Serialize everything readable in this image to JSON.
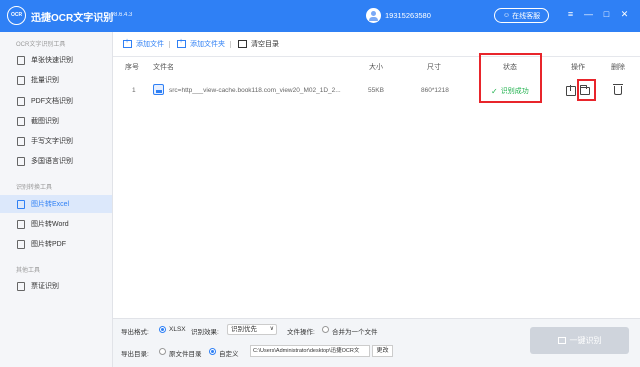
{
  "app": {
    "logo_text": "OCR",
    "title": "迅捷OCR文字识别",
    "version": "v8.6.4.3",
    "user_phone": "19315263580",
    "service_label": "在线客服"
  },
  "window_controls": {
    "menu": "≡",
    "minimize": "—",
    "maximize": "□",
    "close": "✕"
  },
  "sidebar": {
    "sections": [
      {
        "title": "OCR文字识别工具",
        "items": [
          {
            "label": "单张快速识别",
            "icon": "image-icon"
          },
          {
            "label": "批量识别",
            "icon": "batch-icon"
          },
          {
            "label": "PDF文档识别",
            "icon": "pdf-icon"
          },
          {
            "label": "截图识别",
            "icon": "screenshot-icon"
          },
          {
            "label": "手写文字识别",
            "icon": "handwriting-icon"
          },
          {
            "label": "多国语言识别",
            "icon": "globe-icon"
          }
        ]
      },
      {
        "title": "识别转换工具",
        "items": [
          {
            "label": "图片转Excel",
            "icon": "excel-icon",
            "active": true
          },
          {
            "label": "图片转Word",
            "icon": "word-icon"
          },
          {
            "label": "图片转PDF",
            "icon": "pdf-icon"
          }
        ]
      },
      {
        "title": "其他工具",
        "items": [
          {
            "label": "票证识别",
            "icon": "ticket-icon"
          }
        ]
      }
    ]
  },
  "toolbar": {
    "add_file": "添加文件",
    "add_folder": "添加文件夹",
    "clear_list": "清空目录"
  },
  "table": {
    "headers": {
      "index": "序号",
      "filename": "文件名",
      "size": "大小",
      "dimensions": "尺寸",
      "status": "状态",
      "actions": "操作",
      "delete": "删除"
    },
    "rows": [
      {
        "index": "1",
        "filename": "src=http___view-cache.book118.com_view20_M02_1D_2...",
        "size": "55KB",
        "dimensions": "860*1218",
        "status": "识别成功"
      }
    ]
  },
  "bottom": {
    "export_format_label": "导出格式:",
    "format_xlsx": "XLSX",
    "effect_label": "识别效果:",
    "effect_value": "识别优先",
    "file_op_label": "文件操作:",
    "merge_label": "合并为一个文件",
    "output_dir_label": "导出目录:",
    "original_dir": "原文件目录",
    "custom_dir": "自定义",
    "path_value": "C:\\Users\\Administrator\\desktop\\迅捷OCR文",
    "change_button": "更改",
    "recognize_button": "一键识别"
  },
  "colors": {
    "primary": "#2f80f5",
    "success": "#20b24e",
    "highlight": "#e8252b",
    "disabled": "#cfd4dc"
  }
}
